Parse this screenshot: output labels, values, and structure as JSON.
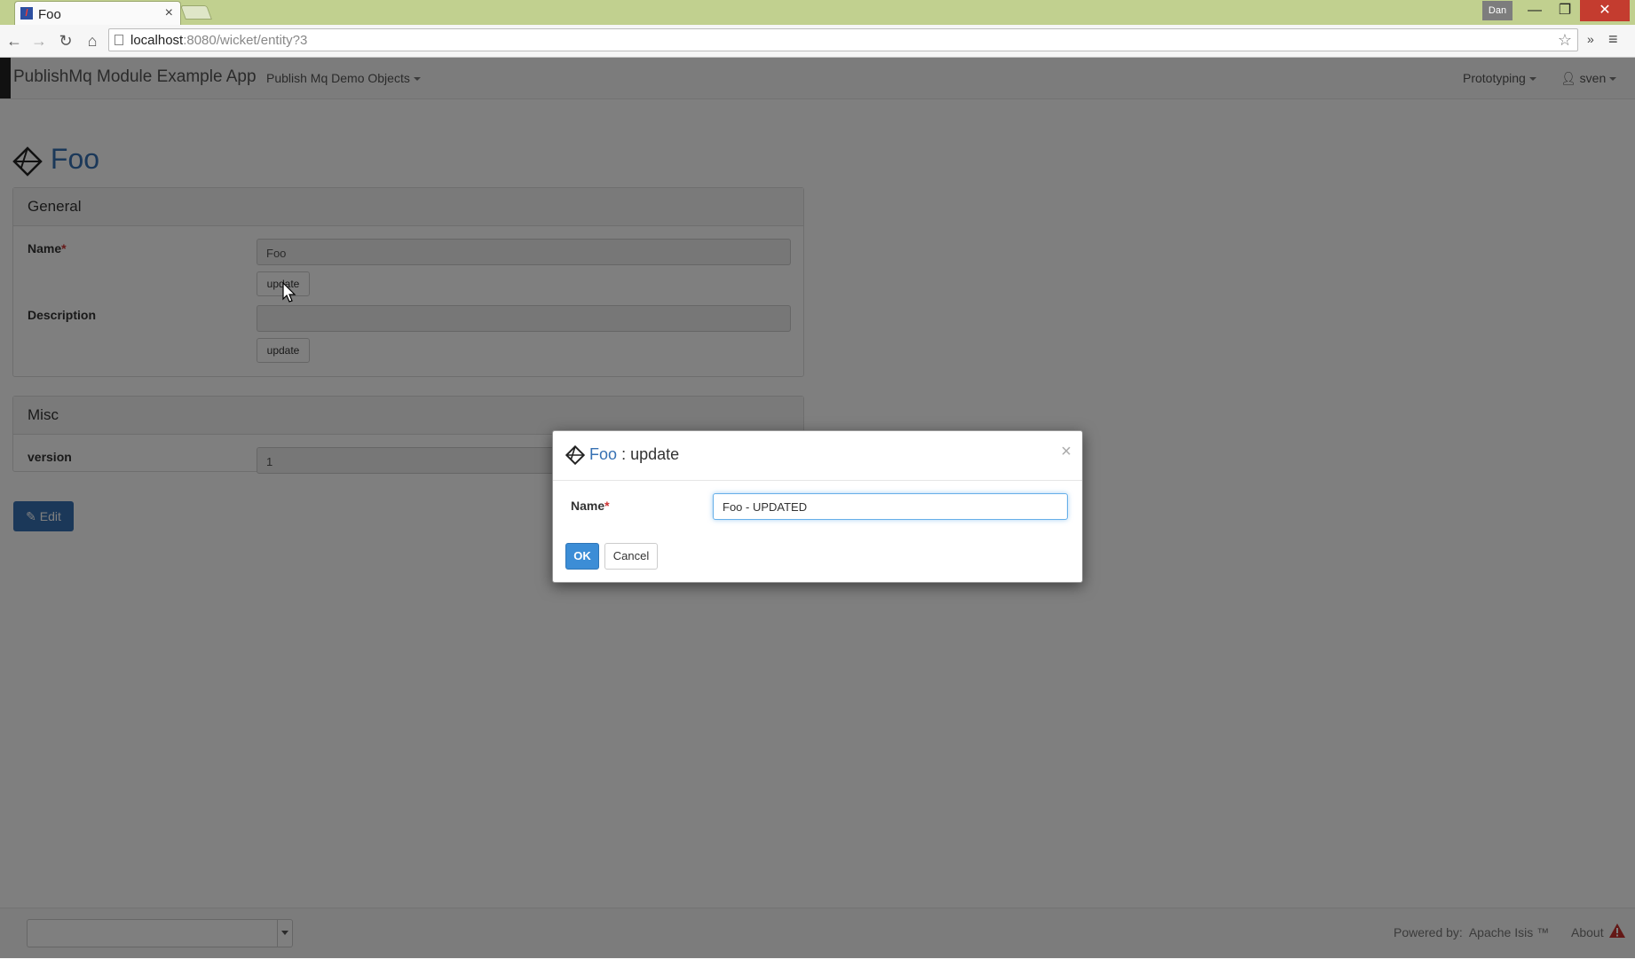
{
  "browser": {
    "tab_title": "Foo",
    "tab_close": "×",
    "profile_name": "Dan",
    "url_host": "localhost",
    "url_rest": ":8080/wicket/entity?3",
    "icons": [
      "back-icon",
      "forward-icon",
      "reload-icon",
      "home-icon",
      "star-icon",
      "menu-icon"
    ]
  },
  "navbar": {
    "brand": "PublishMq Module Example App",
    "menu_demo": "Publish Mq Demo Objects",
    "menu_prototyping": "Prototyping",
    "menu_user": "sven"
  },
  "entity": {
    "title": "Foo",
    "panels": {
      "general": {
        "heading": "General",
        "name_label": "Name",
        "name_value": "Foo",
        "name_update": "update",
        "description_label": "Description",
        "description_value": "",
        "description_update": "update"
      },
      "misc": {
        "heading": "Misc",
        "version_label": "version",
        "version_value": "1"
      }
    },
    "edit_label": "Edit"
  },
  "footer": {
    "powered_by": "Powered by:",
    "framework": "Apache Isis ™",
    "about": "About"
  },
  "dialog": {
    "entity": "Foo",
    "action": ": update",
    "close": "×",
    "name_label": "Name",
    "required_mark": "*",
    "name_input": "Foo - UPDATED",
    "ok_label": "OK",
    "cancel_label": "Cancel"
  },
  "colors": {
    "accent": "#3771b3",
    "tabbar": "#c1d08f",
    "close": "#c43c2f",
    "required": "#cc3333"
  }
}
